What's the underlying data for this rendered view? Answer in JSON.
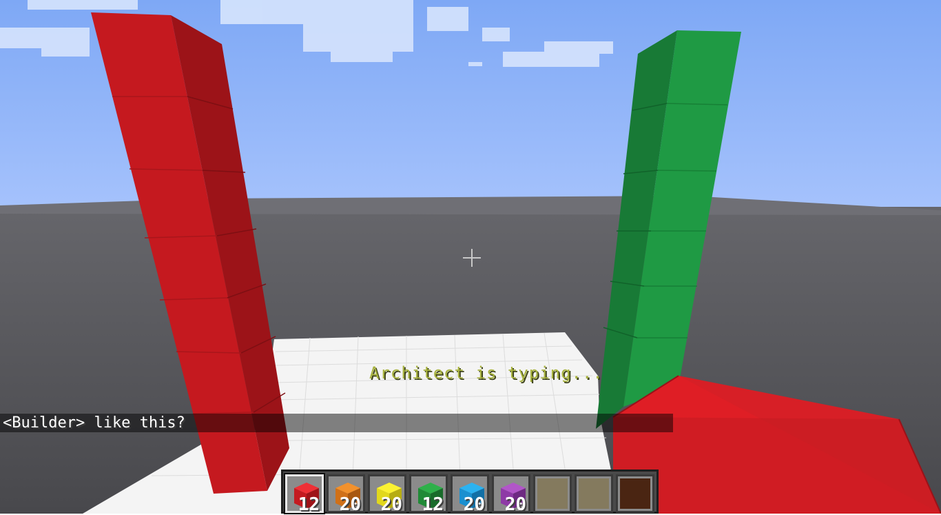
{
  "hud": {
    "status_text": "Architect is typing...",
    "chat": [
      {
        "sender": "<Builder>",
        "message": "like this?",
        "full": "<Builder> like this?"
      }
    ]
  },
  "hotbar": {
    "selected_index": 0,
    "slots": [
      {
        "item": "red-wool-block",
        "count": "12",
        "color": "#d8232a"
      },
      {
        "item": "orange-wool-block",
        "count": "20",
        "color": "#e07a1f"
      },
      {
        "item": "yellow-wool-block",
        "count": "20",
        "color": "#f1e622"
      },
      {
        "item": "green-wool-block",
        "count": "12",
        "color": "#2a9a3b"
      },
      {
        "item": "blue-wool-block",
        "count": "20",
        "color": "#1a9be0"
      },
      {
        "item": "purple-wool-block",
        "count": "20",
        "color": "#9a3fb0"
      },
      {
        "item": "empty-slot",
        "count": "",
        "color": "#847a5e"
      },
      {
        "item": "empty-slot",
        "count": "",
        "color": "#847a5e"
      },
      {
        "item": "empty-slot",
        "count": "",
        "color": "#4a2512"
      }
    ]
  },
  "colors": {
    "sky_top": "#7ea8f5",
    "sky_bottom": "#9dbcfb",
    "ground": "#5a5a5f",
    "floor": "#f4f4f4",
    "red_block": "#d71f26",
    "green_block": "#1f9a44",
    "typing_text": "#a8b33e"
  }
}
